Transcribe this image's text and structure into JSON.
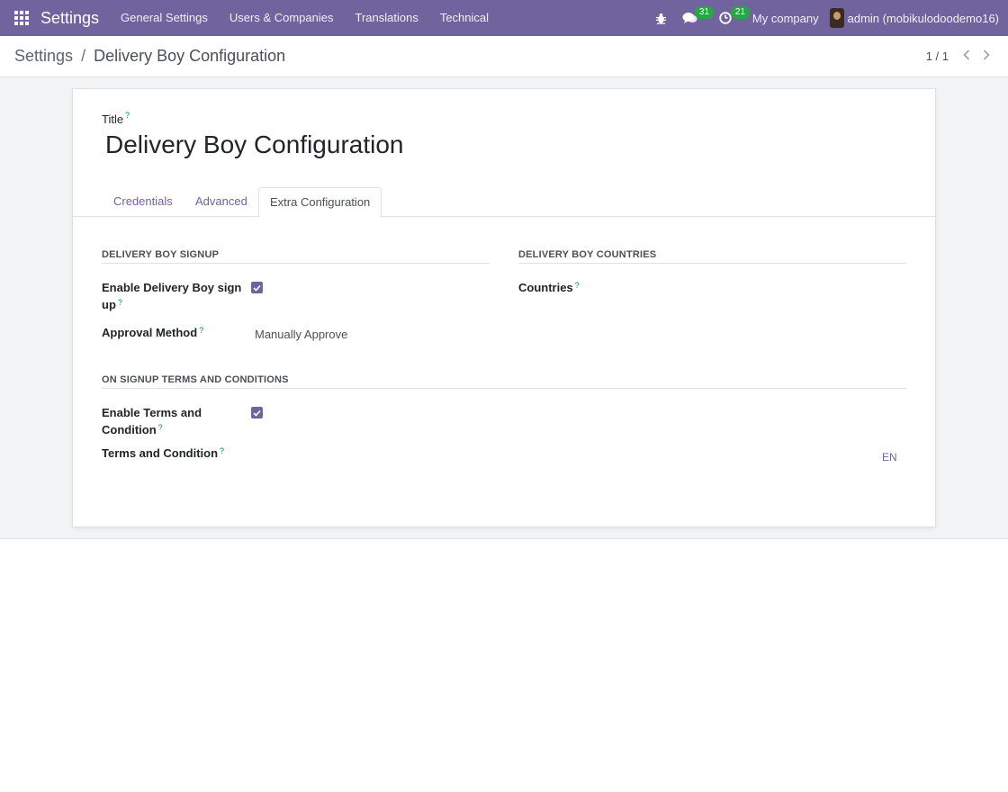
{
  "navbar": {
    "app_name": "Settings",
    "menu": [
      "General Settings",
      "Users & Companies",
      "Translations",
      "Technical"
    ],
    "messages_count": "31",
    "activities_count": "21",
    "company": "My company",
    "user": "admin (mobikulodoodemo16)"
  },
  "breadcrumb": {
    "parent": "Settings",
    "separator": "/",
    "current": "Delivery Boy Configuration"
  },
  "pager": {
    "value": "1 / 1"
  },
  "form": {
    "title_label": "Title",
    "help_mark": "?",
    "title_value": "Delivery Boy Configuration",
    "tabs": [
      "Credentials",
      "Advanced",
      "Extra Configuration"
    ],
    "active_tab": "Extra Configuration",
    "signup_section": {
      "title": "DELIVERY BOY SIGNUP",
      "enable_signup_label_line1": "Enable Delivery Boy sign",
      "enable_signup_label_line2": "up",
      "enable_signup_checked": true,
      "approval_label": "Approval Method",
      "approval_value": "Manually Approve"
    },
    "countries_section": {
      "title": "DELIVERY BOY COUNTRIES",
      "countries_label": "Countries"
    },
    "terms_section": {
      "title": "ON SIGNUP TERMS AND CONDITIONS",
      "enable_terms_label_line1": "Enable Terms and",
      "enable_terms_label_line2": "Condition",
      "enable_terms_checked": true,
      "terms_label": "Terms and Condition",
      "lang": "EN"
    }
  },
  "colors": {
    "brand": "#71639e",
    "badge": "#28a745",
    "help": "#017e84"
  }
}
